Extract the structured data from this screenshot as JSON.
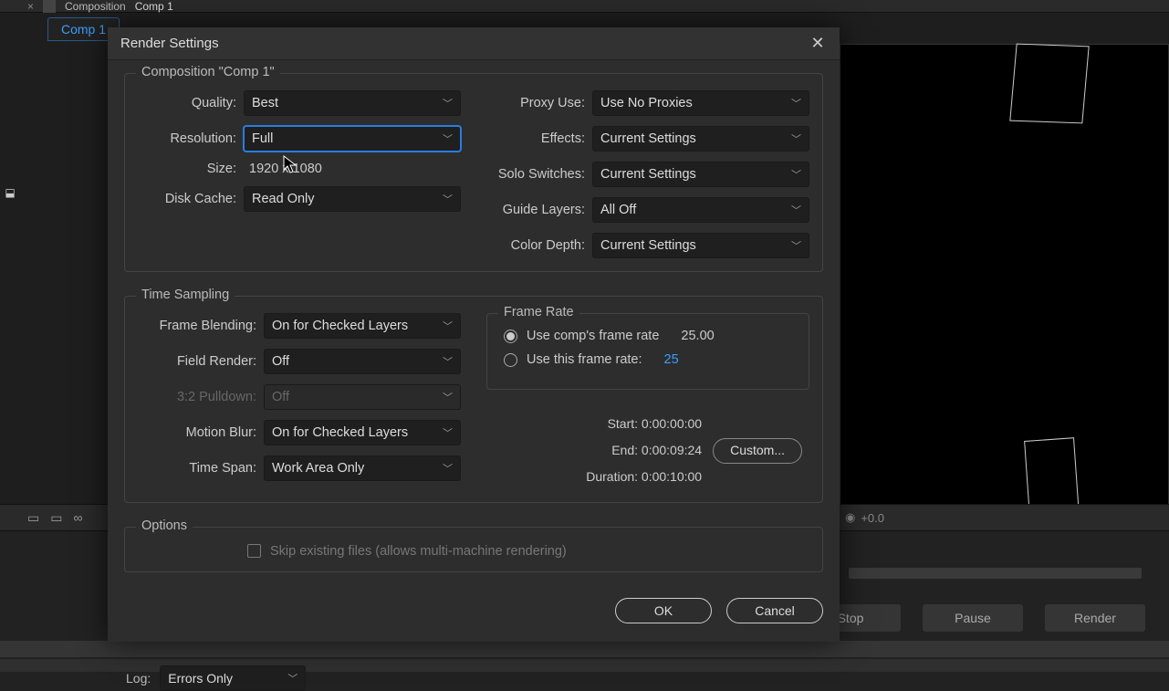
{
  "app": {
    "panel_title_prefix": "Composition",
    "panel_title_name": "Comp 1",
    "comp_tab": "Comp 1",
    "exposure": "+0.0"
  },
  "render_queue": {
    "stop": "Stop",
    "pause": "Pause",
    "render": "Render",
    "log_label": "Log:",
    "log_value": "Errors Only"
  },
  "dialog": {
    "title": "Render Settings",
    "comp_section_title": "Composition \"Comp 1\"",
    "quality_label": "Quality:",
    "quality_value": "Best",
    "resolution_label": "Resolution:",
    "resolution_value": "Full",
    "size_label": "Size:",
    "size_value": "1920 x 1080",
    "disk_cache_label": "Disk Cache:",
    "disk_cache_value": "Read Only",
    "proxy_label": "Proxy Use:",
    "proxy_value": "Use No Proxies",
    "effects_label": "Effects:",
    "effects_value": "Current Settings",
    "solo_label": "Solo Switches:",
    "solo_value": "Current Settings",
    "guide_label": "Guide Layers:",
    "guide_value": "All Off",
    "depth_label": "Color Depth:",
    "depth_value": "Current Settings",
    "time_section_title": "Time Sampling",
    "blend_label": "Frame Blending:",
    "blend_value": "On for Checked Layers",
    "field_label": "Field Render:",
    "field_value": "Off",
    "pulldown_label": "3:2 Pulldown:",
    "pulldown_value": "Off",
    "blur_label": "Motion Blur:",
    "blur_value": "On for Checked Layers",
    "span_label": "Time Span:",
    "span_value": "Work Area Only",
    "fr_title": "Frame Rate",
    "fr_comp_label": "Use comp's frame rate",
    "fr_comp_value": "25.00",
    "fr_this_label": "Use this frame rate:",
    "fr_this_value": "25",
    "start": "Start: 0:00:00:00",
    "end": "End: 0:00:09:24",
    "duration": "Duration: 0:00:10:00",
    "custom": "Custom...",
    "options_title": "Options",
    "skip_label": "Skip existing files (allows multi-machine rendering)",
    "ok": "OK",
    "cancel": "Cancel"
  }
}
